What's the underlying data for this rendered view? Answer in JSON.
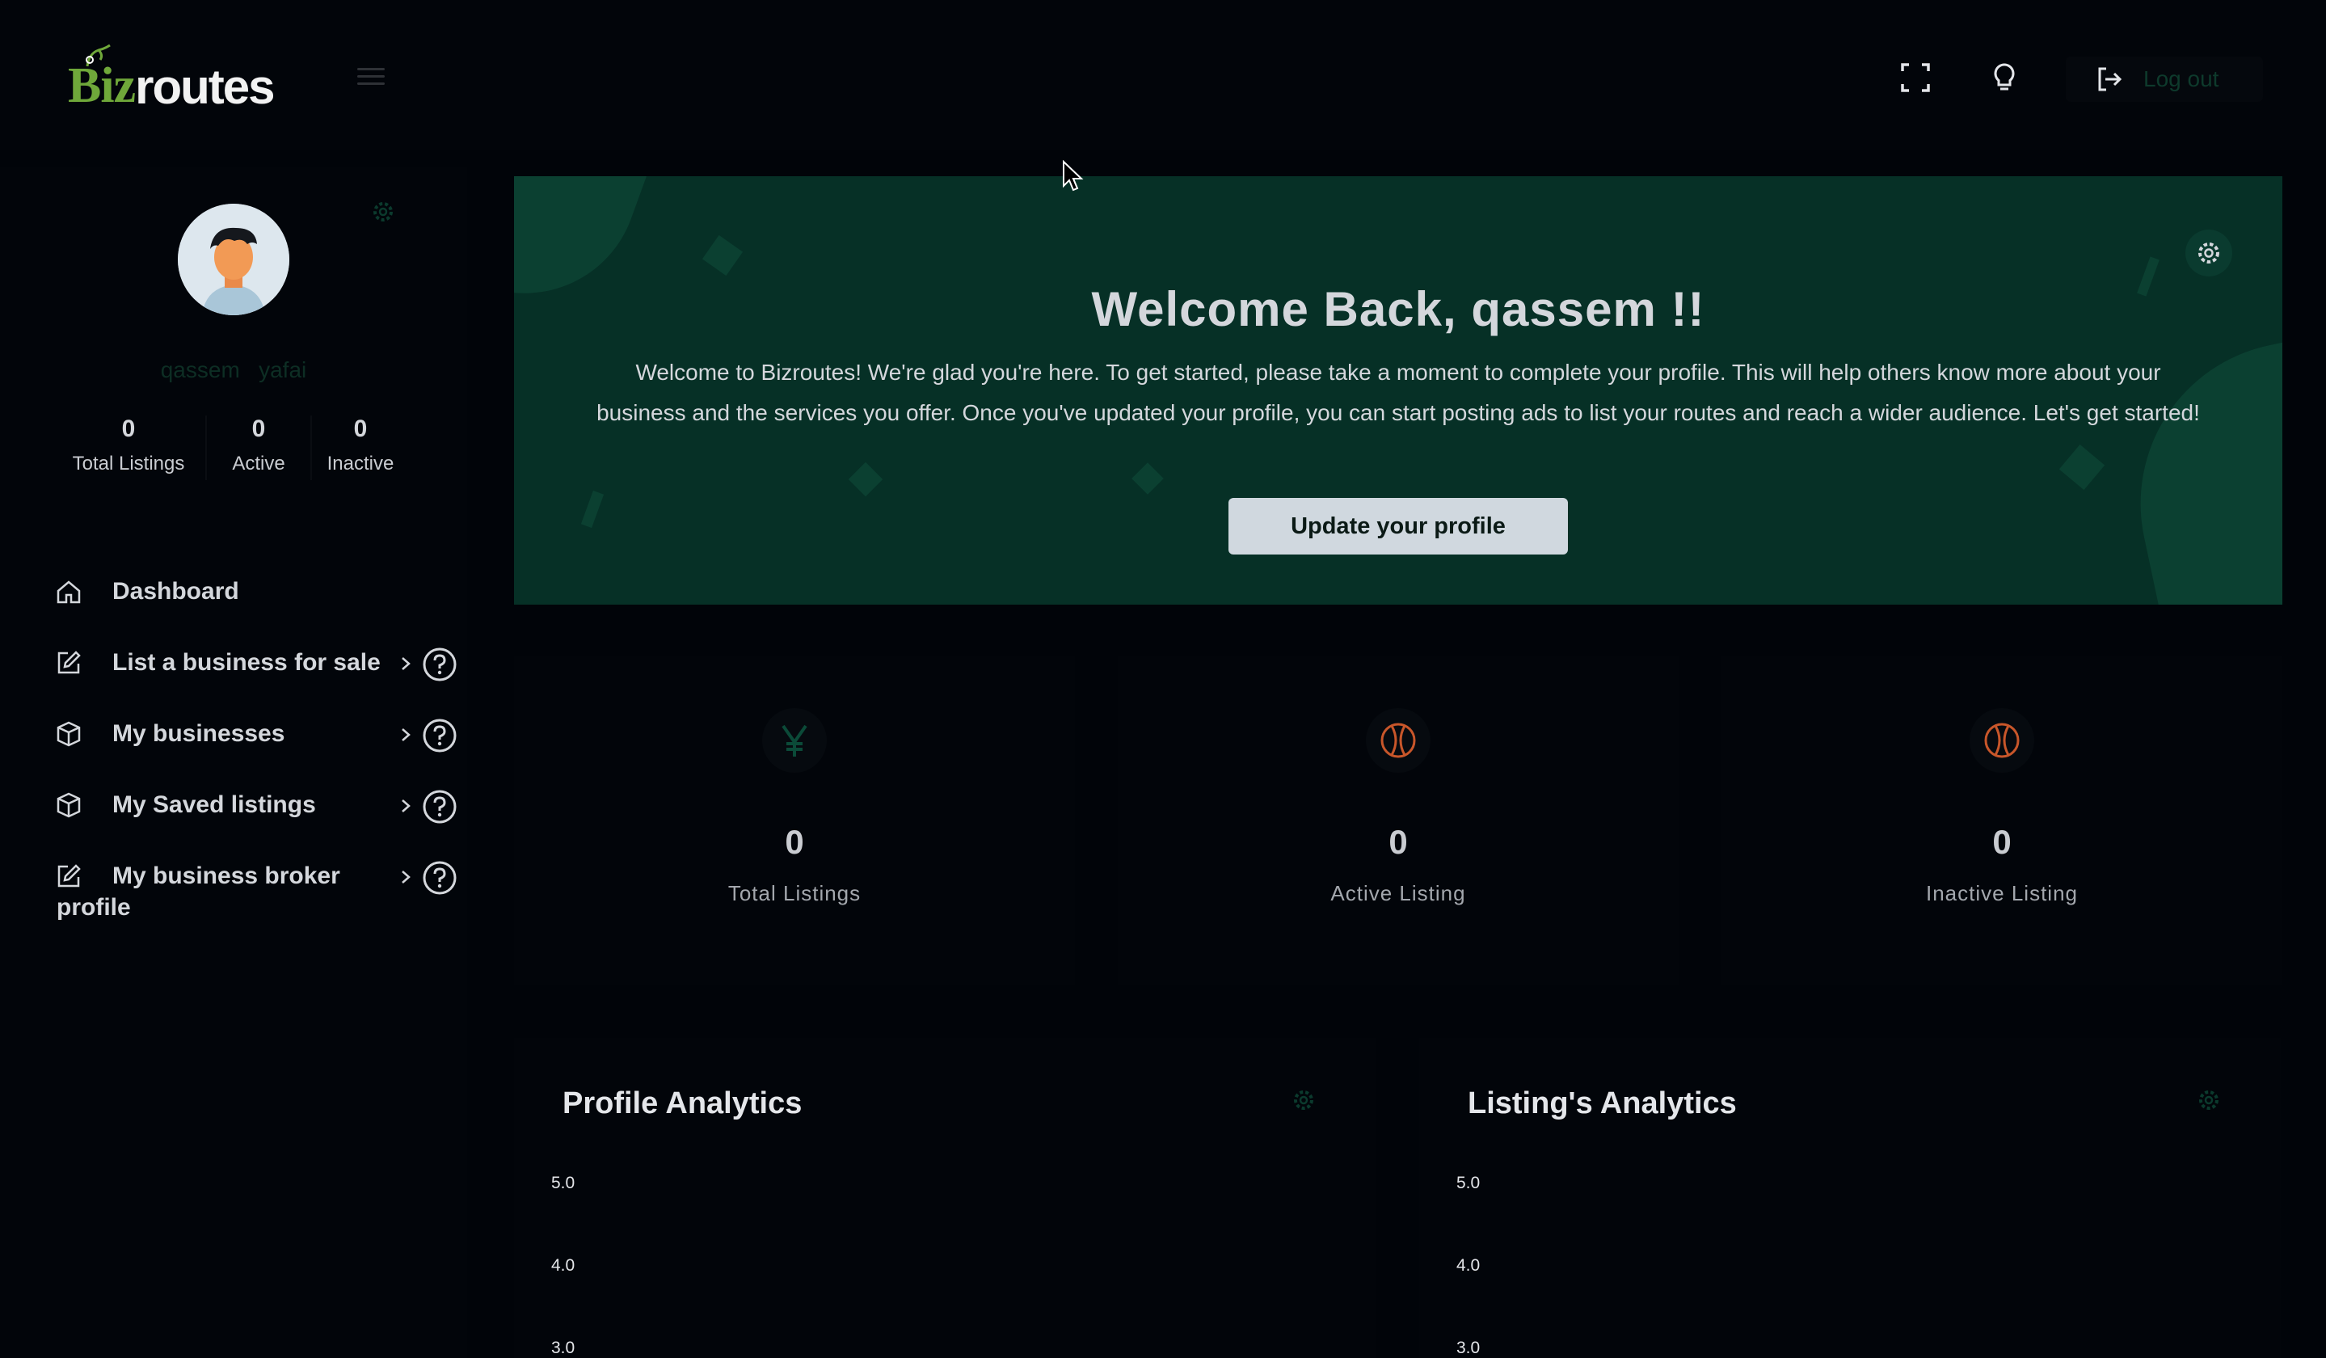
{
  "brand": {
    "logo_left": "Biz",
    "logo_right": "routes"
  },
  "header": {
    "logout_label": "Log out"
  },
  "sidebar": {
    "user_name": "qassem   yafai",
    "stats": [
      {
        "value": "0",
        "label": "Total Listings"
      },
      {
        "value": "0",
        "label": "Active"
      },
      {
        "value": "0",
        "label": "Inactive"
      }
    ],
    "nav": [
      {
        "label": "Dashboard"
      },
      {
        "label": "List a business for sale"
      },
      {
        "label": "My businesses"
      },
      {
        "label": "My Saved listings"
      },
      {
        "label_line1": "My business broker",
        "label_line2": "profile"
      }
    ]
  },
  "banner": {
    "title": "Welcome Back, qassem !!",
    "text": "Welcome to Bizroutes! We're glad you're here. To get started, please take a moment to complete your profile. This will help others know more about your business and the services you offer. Once you've updated your profile, you can start posting ads to list your routes and reach a wider audience. Let's get started!",
    "button_label": "Update your profile"
  },
  "cards": [
    {
      "value": "0",
      "label": "Total Listings",
      "icon": "yen-icon",
      "icon_color": "#0b4a38"
    },
    {
      "value": "0",
      "label": "Active Listing",
      "icon": "basketball-icon",
      "icon_color": "#c8562a"
    },
    {
      "value": "0",
      "label": "Inactive Listing",
      "icon": "basketball-icon",
      "icon_color": "#c8562a"
    }
  ],
  "panels": [
    {
      "title": "Profile Analytics",
      "ticks": [
        "5.0",
        "4.0",
        "3.0"
      ]
    },
    {
      "title": "Listing's Analytics",
      "ticks": [
        "5.0",
        "4.0",
        "3.0"
      ]
    }
  ],
  "colors": {
    "brand_green": "#6fa83a",
    "banner_bg": "#063026",
    "page_bg": "#010409"
  }
}
